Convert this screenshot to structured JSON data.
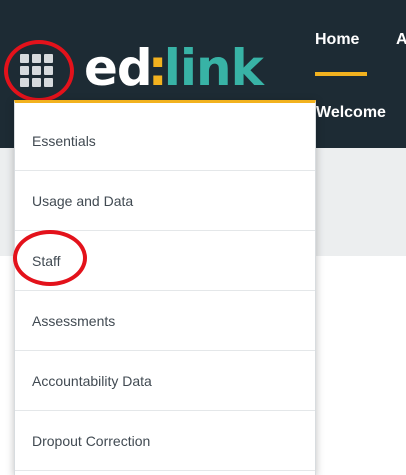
{
  "brand": {
    "logo_left": "ed",
    "logo_mark": ":",
    "logo_right": "link"
  },
  "nav": {
    "home_label": "Home",
    "next_label": "A",
    "welcome_text": "Welcome"
  },
  "menu": {
    "items": [
      {
        "label": "Essentials"
      },
      {
        "label": "Usage and Data"
      },
      {
        "label": "Staff"
      },
      {
        "label": "Assessments"
      },
      {
        "label": "Accountability Data"
      },
      {
        "label": "Dropout Correction"
      }
    ]
  },
  "annotations": {
    "highlight_color": "#e3121b"
  },
  "colors": {
    "topbar": "#1d2b34",
    "accent": "#f2b21f",
    "brand_teal": "#38b3a6"
  }
}
